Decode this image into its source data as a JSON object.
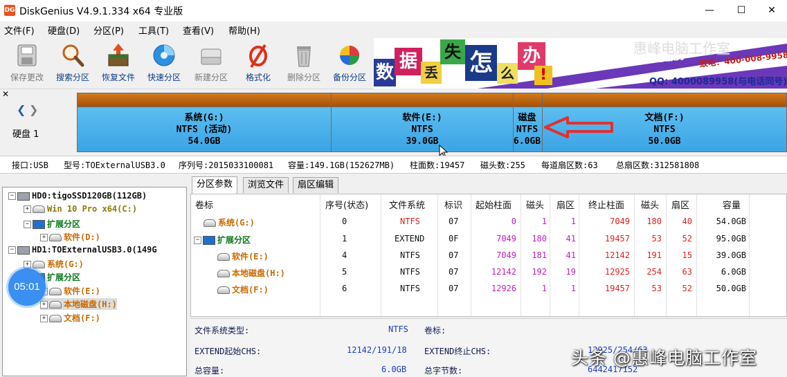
{
  "window": {
    "app_icon": "DG",
    "title": "DiskGenius V4.9.1.334 x64 专业版",
    "minimize": "—",
    "maximize": "☐",
    "close": "✕"
  },
  "menu": [
    "文件(F)",
    "硬盘(D)",
    "分区(P)",
    "工具(T)",
    "查看(V)",
    "帮助(H)"
  ],
  "toolbar": [
    {
      "label": "保存更改",
      "icon": "save-icon",
      "enabled": false
    },
    {
      "label": "搜索分区",
      "icon": "magnifier-icon",
      "enabled": true
    },
    {
      "label": "恢复文件",
      "icon": "recover-box-icon",
      "enabled": true
    },
    {
      "label": "快速分区",
      "icon": "disc-icon",
      "enabled": true
    },
    {
      "label": "新建分区",
      "icon": "new-partition-icon",
      "enabled": false
    },
    {
      "label": "格式化",
      "icon": "format-icon",
      "enabled": true
    },
    {
      "label": "删除分区",
      "icon": "trash-icon",
      "enabled": false
    },
    {
      "label": "备份分区",
      "icon": "backup-ball-icon",
      "enabled": true
    }
  ],
  "banner": {
    "chars": [
      "数",
      "据",
      "丢",
      "失",
      "怎",
      "么",
      "办",
      "!"
    ],
    "brand": "DiskGenius团队为您服务",
    "phone": "致电：400-008-9958",
    "qq": "QQ: 4000089958(与电话同号)"
  },
  "overlay_watermark_top": "惠峰电脑工作室",
  "diskmap": {
    "disk_label": "硬盘 1",
    "partitions": [
      {
        "name": "系统(G:)",
        "fs": "NTFS (活动)",
        "size": "54.0GB"
      },
      {
        "name": "软件(E:)",
        "fs": "NTFS",
        "size": "39.0GB"
      },
      {
        "name": "磁盘",
        "fs": "NTFS",
        "size": "6.0GB"
      },
      {
        "name": "文档(F:)",
        "fs": "NTFS",
        "size": "50.0GB"
      }
    ]
  },
  "infoline": {
    "interface": "接口:USB",
    "model": "型号:TOExternalUSB3.0",
    "serial": "序列号:2015033100081",
    "capacity": "容量:149.1GB(152627MB)",
    "cylinders": "柱面数:19457",
    "heads": "磁头数:255",
    "sectors_per_track": "每道扇区数:63",
    "total_sectors": "总扇区数:312581808"
  },
  "tree": {
    "hd0": "HD0:tigoSSD120GB(112GB)",
    "hd0_win": "Win 10 Pro x64(C:)",
    "hd0_ext": "扩展分区",
    "hd0_soft": "软件(D:)",
    "hd1": "HD1:TOExternalUSB3.0(149G",
    "hd1_sys": "系统(G:)",
    "hd1_ext": "扩展分区",
    "hd1_soft": "软件(E:)",
    "hd1_local": "本地磁盘(H:)",
    "hd1_doc": "文档(F:)"
  },
  "timer": "05:01",
  "tabs": [
    "分区参数",
    "浏览文件",
    "扇区编辑"
  ],
  "table": {
    "headers": [
      "卷标",
      "序号(状态)",
      "文件系统",
      "标识",
      "起始柱面",
      "磁头",
      "扇区",
      "终止柱面",
      "磁头",
      "扇区",
      "容量"
    ],
    "rows": [
      [
        "系统(G:)",
        "0",
        "NTFS",
        "07",
        "0",
        "1",
        "1",
        "7049",
        "180",
        "40",
        "54.0GB"
      ],
      [
        "扩展分区",
        "1",
        "EXTEND",
        "0F",
        "7049",
        "180",
        "41",
        "19457",
        "53",
        "52",
        "95.0GB"
      ],
      [
        "软件(E:)",
        "4",
        "NTFS",
        "07",
        "7049",
        "181",
        "41",
        "12142",
        "191",
        "15",
        "39.0GB"
      ],
      [
        "本地磁盘(H:)",
        "5",
        "NTFS",
        "07",
        "12142",
        "192",
        "19",
        "12925",
        "254",
        "63",
        "6.0GB"
      ],
      [
        "文档(F:)",
        "6",
        "NTFS",
        "07",
        "12926",
        "1",
        "1",
        "19457",
        "53",
        "52",
        "50.0GB"
      ]
    ]
  },
  "details": {
    "fs_type_label": "文件系统类型:",
    "fs_type_value": "NTFS",
    "volume_label": "卷标:",
    "ext_start_label": "EXTEND起始CHS:",
    "ext_start_value": "12142/191/18",
    "ext_end_label": "EXTEND终止CHS:",
    "ext_end_value": "12925/254/63",
    "total_cap_label": "总容量:",
    "total_cap_value": "6.0GB",
    "total_bytes_label": "总字节数:",
    "total_bytes_value": "6442417152"
  },
  "watermark": "头条 @惠峰电脑工作室",
  "colors": {
    "partition_cap": "#c06a12",
    "partition_body": "#4fb2ec",
    "arrow": "#e03030",
    "link_blue": "#0f3c8a"
  }
}
